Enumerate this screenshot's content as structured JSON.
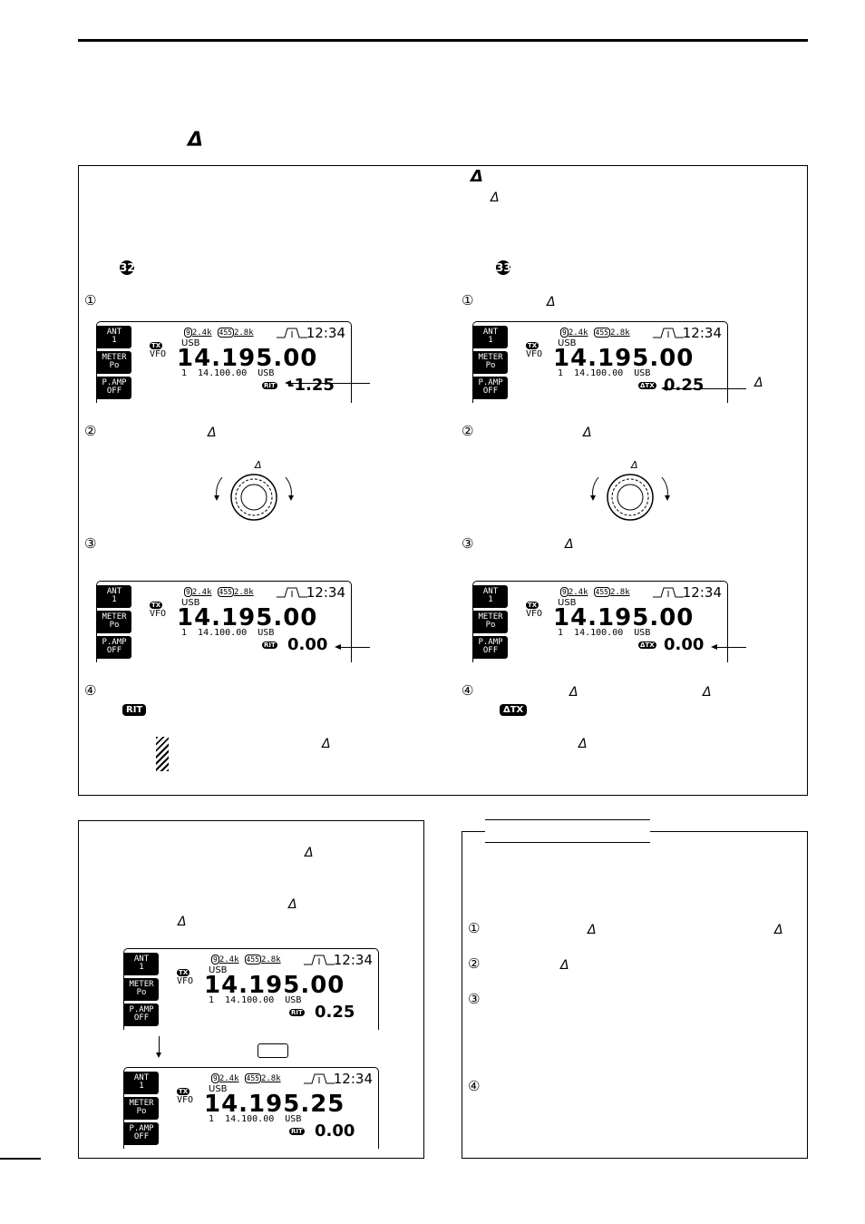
{
  "page": {
    "section_title_symbol": "Δ",
    "main_box": {
      "right_heading_symbol": "Δ",
      "right_subheading_symbol": "Δ",
      "left_key_ref": "㉜",
      "right_key_ref": "㉝"
    },
    "left_column": {
      "steps": [
        {
          "num": "①",
          "symbol": ""
        },
        {
          "num": "②",
          "symbol": "Δ"
        },
        {
          "num": "③",
          "symbol": ""
        },
        {
          "num": "④",
          "symbol": ""
        }
      ],
      "dial_label": "Δ",
      "step4_badge": "RIT",
      "note_symbol": "Δ"
    },
    "right_column": {
      "steps": [
        {
          "num": "①",
          "symbol": "Δ"
        },
        {
          "num": "②",
          "symbol": "Δ"
        },
        {
          "num": "③",
          "symbol": "Δ"
        },
        {
          "num": "④",
          "symbol": "Δ",
          "symbol2": "Δ"
        }
      ],
      "dial_label": "Δ",
      "callout_label": "Δ",
      "step4_badge": "ΔTX",
      "note_symbol": "Δ"
    },
    "bottom_left_box": {
      "symbols": [
        "Δ",
        "Δ",
        "Δ"
      ]
    },
    "bottom_right_box": {
      "steps": [
        {
          "num": "①",
          "symbol": "Δ",
          "symbol2": "Δ"
        },
        {
          "num": "②",
          "symbol": "Δ"
        },
        {
          "num": "③"
        },
        {
          "num": "④"
        }
      ]
    }
  },
  "displays": {
    "common": {
      "keys": [
        {
          "line1": "ANT",
          "line2": "1"
        },
        {
          "line1": "METER",
          "line2": "Po"
        },
        {
          "line1": "P.AMP",
          "line2": "OFF"
        }
      ],
      "filter1_tag": "9",
      "filter1_bw": "2.4k",
      "filter2_tag": "455",
      "filter2_bw": "2.8k",
      "clock": "12:34",
      "tx_badge": "TX",
      "vfo": "VFO",
      "mode": "USB",
      "sub_line": "1  14.100.00  USB"
    },
    "d1": {
      "freq": "14.195.00",
      "offset_badge": "RIT",
      "offset": "-1.25"
    },
    "d2": {
      "freq": "14.195.00",
      "offset_badge": "ΔTX",
      "offset": "0.25"
    },
    "d3": {
      "freq": "14.195.00",
      "offset_badge": "RIT",
      "offset": "0.00"
    },
    "d4": {
      "freq": "14.195.00",
      "offset_badge": "ΔTX",
      "offset": "0.00"
    },
    "d5": {
      "freq": "14.195.00",
      "offset_badge": "RIT",
      "offset": "0.25"
    },
    "d6": {
      "freq": "14.195.25",
      "offset_badge": "RIT",
      "offset": "0.00"
    }
  }
}
